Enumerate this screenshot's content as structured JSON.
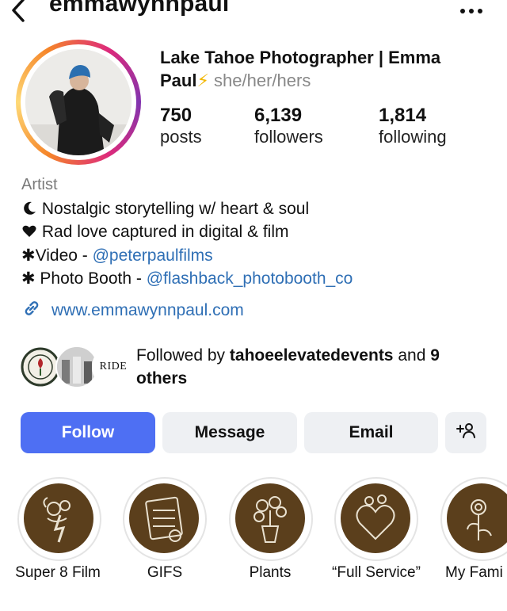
{
  "header": {
    "username": "emmawynnpaul",
    "back_icon": "chevron-left-icon",
    "more_icon": "ellipsis-icon"
  },
  "profile": {
    "name_line": "Lake Tahoe Photographer | Emma Paul",
    "bolt": "⚡",
    "pronouns": "she/her/hers",
    "stats": [
      {
        "value": "750",
        "label": "posts"
      },
      {
        "value": "6,139",
        "label": "followers"
      },
      {
        "value": "1,814",
        "label": "following"
      }
    ]
  },
  "bio": {
    "category": "Artist",
    "lines": [
      {
        "icon": "moon-icon",
        "text": "Nostalgic storytelling w/ heart & soul"
      },
      {
        "icon": "heart-icon",
        "text": "Rad love captured in digital & film"
      },
      {
        "prefix": "✱Video - ",
        "mention": "@peterpaulfilms"
      },
      {
        "prefix": "✱ Photo Booth - ",
        "mention": "@flashback_photobooth_co"
      }
    ],
    "website": "www.emmawynnpaul.com"
  },
  "followed_by": {
    "prefix": "Followed by ",
    "account": "tahoeelevatedevents",
    "and": " and ",
    "others": "9 others",
    "avatar_badge_text": "RIDE"
  },
  "actions": {
    "follow": "Follow",
    "message": "Message",
    "email": "Email",
    "add_person_icon": "+"
  },
  "highlights": [
    {
      "label": "Super 8 Film"
    },
    {
      "label": "GIFS"
    },
    {
      "label": "Plants"
    },
    {
      "label": "“Full Service”"
    },
    {
      "label": "My Fami"
    }
  ],
  "colors": {
    "accent": "#4e6ff3",
    "link": "#2f6fb5",
    "highlight_bg": "#5b3f1c",
    "button_bg": "#eef0f3"
  }
}
